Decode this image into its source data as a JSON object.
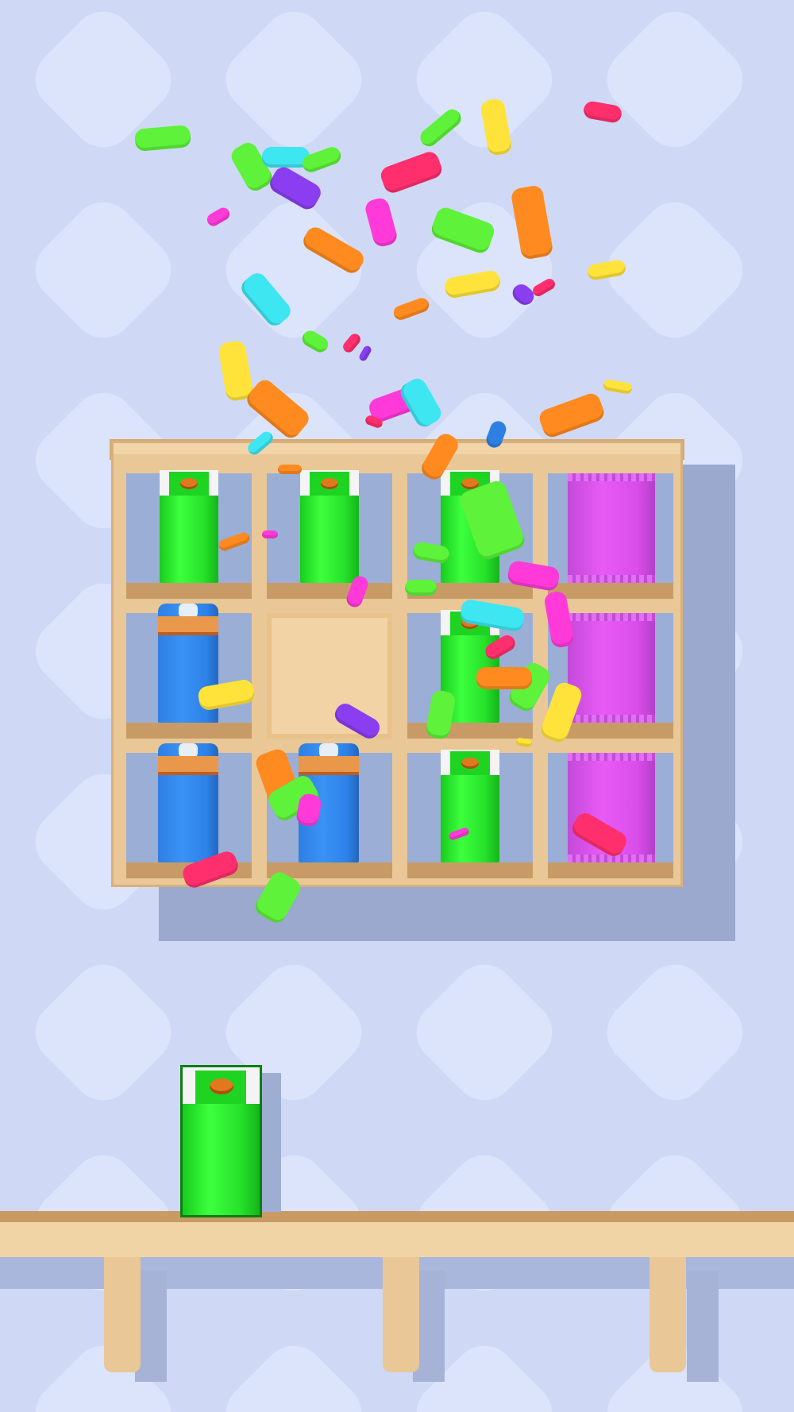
{
  "scene": {
    "background_color": "#cfd9f5",
    "wood_color": "#e9c796",
    "confetti_colors": [
      "#5ef23a",
      "#ff2f6e",
      "#ffe33a",
      "#3ee6f2",
      "#8a3ef0",
      "#ff8a1f",
      "#ff3ad9",
      "#2f7fe2"
    ]
  },
  "rack": {
    "rows": 3,
    "cols": 4,
    "cells": [
      {
        "item": "green-carton"
      },
      {
        "item": "green-carton"
      },
      {
        "item": "green-carton"
      },
      {
        "item": "purple-bag"
      },
      {
        "item": "blue-bread"
      },
      {
        "item": "empty"
      },
      {
        "item": "green-carton"
      },
      {
        "item": "purple-bag"
      },
      {
        "item": "blue-bread"
      },
      {
        "item": "blue-bread"
      },
      {
        "item": "green-carton"
      },
      {
        "item": "purple-bag"
      }
    ]
  },
  "held_item": {
    "item": "green-carton"
  }
}
